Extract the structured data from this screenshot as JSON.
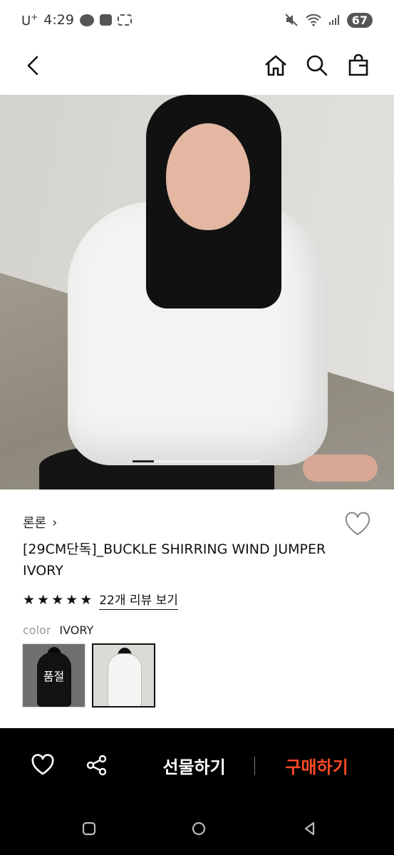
{
  "status_bar": {
    "carrier": "U",
    "carrier_sup": "+",
    "time": "4:29",
    "battery": "67"
  },
  "icons": {
    "back": "chevron-left-icon",
    "home": "home-icon",
    "search": "search-icon",
    "bag": "shopping-bag-icon",
    "wishlist": "heart-outline-icon",
    "share": "share-icon"
  },
  "product": {
    "brand": "론론",
    "brand_chevron": "›",
    "title": "[29CM단독]_BUCKLE SHIRRING WIND JUMPER IVORY",
    "rating_stars": 5,
    "review_link": "22개 리뷰 보기",
    "color_label": "color",
    "color_value": "IVORY",
    "swatches": [
      {
        "state": "sold_out",
        "overlay_text": "품절"
      },
      {
        "state": "selected"
      }
    ]
  },
  "action_bar": {
    "gift_label": "선물하기",
    "buy_label": "구매하기",
    "buy_color": "#ff4a26"
  }
}
